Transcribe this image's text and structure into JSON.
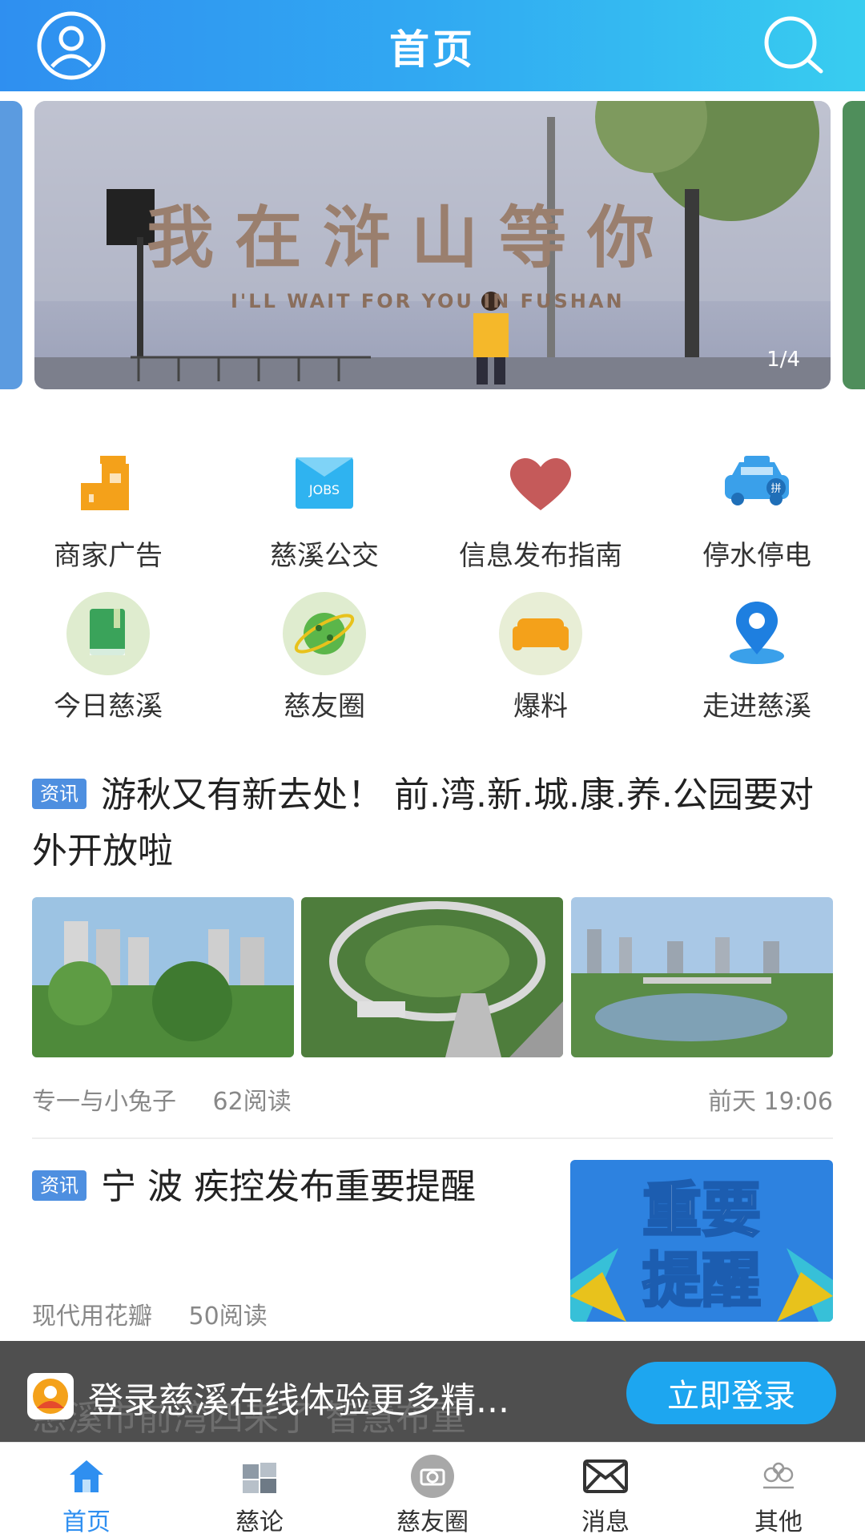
{
  "header": {
    "title": "首页",
    "left_icon": "user-icon",
    "right_icon": "search-icon"
  },
  "banner": {
    "sign_text": "我在浒山等你",
    "sign_subtext": "I'LL WAIT FOR YOU IN FUSHAN",
    "counter": "1/4"
  },
  "shortcuts": [
    {
      "label": "商家广告",
      "icon": "shop-ad-icon"
    },
    {
      "label": "慈溪公交",
      "icon": "jobs-icon"
    },
    {
      "label": "信息发布指南",
      "icon": "heart-icon"
    },
    {
      "label": "停水停电",
      "icon": "car-icon"
    },
    {
      "label": "今日慈溪",
      "icon": "book-icon"
    },
    {
      "label": "慈友圈",
      "icon": "planet-icon"
    },
    {
      "label": "爆料",
      "icon": "sofa-icon"
    },
    {
      "label": "走进慈溪",
      "icon": "location-pin-icon"
    }
  ],
  "jobs_text": "JOBS",
  "news": [
    {
      "tag": "资讯",
      "title": "游秋又有新去处！ 前.湾.新.城.康.养.公园要对外开放啦",
      "author": "专一与小兔子",
      "reads": "62阅读",
      "time": "前天 19:06"
    },
    {
      "tag": "资讯",
      "title": "宁 波 疾控发布重要提醒",
      "author": "现代用花瓣",
      "reads": "50阅读",
      "image_text_line1": "重要",
      "image_text_line2": "提醒"
    }
  ],
  "login_bar": {
    "text": "登录慈溪在线体验更多精...",
    "button": "立即登录",
    "underlay_text": "慈溪市前湾四来了 智慧布重"
  },
  "tabs": [
    {
      "label": "首页",
      "icon": "home-icon"
    },
    {
      "label": "慈论",
      "icon": "puzzle-icon"
    },
    {
      "label": "慈友圈",
      "icon": "camera-icon"
    },
    {
      "label": "消息",
      "icon": "mail-icon"
    },
    {
      "label": "其他",
      "icon": "more-icon"
    }
  ],
  "colors": {
    "header_start": "#2f8ff0",
    "header_end": "#38cdf0",
    "tag": "#4e8fe0",
    "login_button": "#1da6f0",
    "active_tab": "#2f8ff0"
  }
}
